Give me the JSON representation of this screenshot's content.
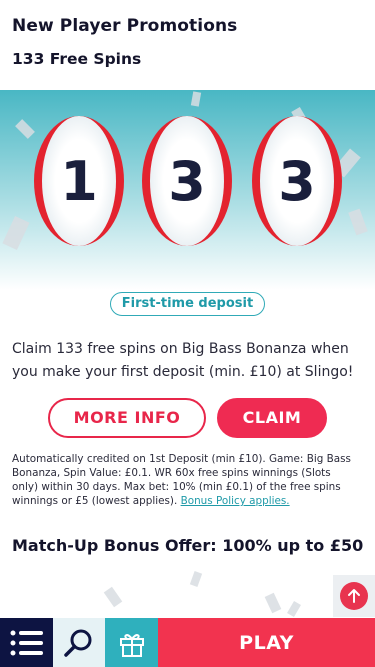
{
  "header": {
    "title": "New Player Promotions",
    "subtitle": "133 Free Spins"
  },
  "hero": {
    "reels": [
      "1",
      "3",
      "3"
    ]
  },
  "promo": {
    "chip": "First-time deposit",
    "description": "Claim 133 free spins on Big Bass Bonanza when you make your first deposit (min. £10) at Slingo!",
    "more_info_label": "MORE INFO",
    "claim_label": "CLAIM",
    "terms": "Automatically credited on 1st Deposit (min £10). Game: Big Bass Bonanza, Spin Value: £0.1. WR 60x free spins winnings (Slots only) within 30 days. Max bet: 10% (min £0.1) of the free spins winnings or £5 (lowest applies).",
    "terms_link": "Bonus Policy applies."
  },
  "next_offer": {
    "title": "Match-Up Bonus Offer: 100% up to £50"
  },
  "bottom_nav": {
    "play_label": "PLAY",
    "icons": [
      "menu-icon",
      "search-icon",
      "gift-icon"
    ]
  },
  "colors": {
    "accent": "#ef2b52",
    "teal": "#2fb0bd",
    "navy": "#0d1442"
  }
}
